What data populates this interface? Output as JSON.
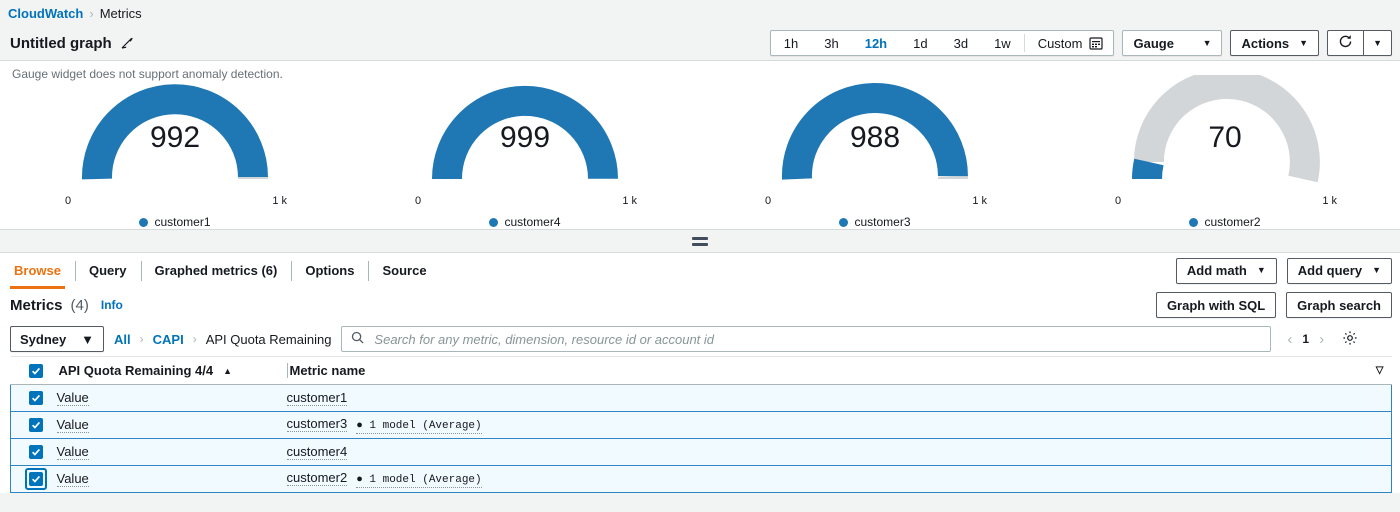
{
  "breadcrumb": {
    "root": "CloudWatch",
    "separator": "›",
    "current": "Metrics"
  },
  "header": {
    "graph_title": "Untitled graph",
    "edit_icon": "pencil-icon",
    "time_ranges": [
      "1h",
      "3h",
      "12h",
      "1d",
      "3d",
      "1w"
    ],
    "active_range": "12h",
    "custom_label": "Custom",
    "calendar_icon": "calendar-icon",
    "widget_type": "Gauge",
    "actions_label": "Actions",
    "refresh_icon": "refresh-icon",
    "caret": "▼"
  },
  "graph": {
    "anomaly_note": "Gauge widget does not support anomaly detection.",
    "min_label": "0",
    "max_label": "1 k",
    "accent_color": "#1f77b4",
    "track_color": "#d2d6d8"
  },
  "chart_data": {
    "type": "gauge",
    "title": "Untitled graph",
    "unit_max_label": "1 k",
    "unit_min_label": "0",
    "range": [
      0,
      1000
    ],
    "series": [
      {
        "name": "customer1",
        "value": 992,
        "display": "992"
      },
      {
        "name": "customer4",
        "value": 999,
        "display": "999"
      },
      {
        "name": "customer3",
        "value": 988,
        "display": "988"
      },
      {
        "name": "customer2",
        "value": 70,
        "display": "70"
      }
    ],
    "legend_position": "bottom",
    "grid": false,
    "xlabel": "",
    "ylabel": ""
  },
  "tabs": {
    "items": [
      {
        "label": "Browse",
        "active": true
      },
      {
        "label": "Query",
        "active": false
      },
      {
        "label": "Graphed metrics (6)",
        "active": false
      },
      {
        "label": "Options",
        "active": false
      },
      {
        "label": "Source",
        "active": false
      }
    ],
    "add_math": "Add math",
    "add_query": "Add query"
  },
  "metrics": {
    "title": "Metrics",
    "count": "(4)",
    "info": "Info",
    "graph_with_sql": "Graph with SQL",
    "graph_search": "Graph search",
    "region": "Sydney",
    "crumbs": [
      {
        "label": "All",
        "link": true
      },
      {
        "label": "CAPI",
        "link": true
      },
      {
        "label": "API Quota Remaining",
        "link": false
      }
    ],
    "crumb_sep": "›",
    "search_placeholder": "Search for any metric, dimension, resource id or account id",
    "search_value": "",
    "search_icon": "search-icon",
    "page_number": "1",
    "prev_icon": "chevron-left-icon",
    "next_icon": "chevron-right-icon",
    "settings_icon": "gear-icon",
    "columns": {
      "checkbox": "select-all",
      "first": "API Quota Remaining 4/4",
      "sort_indicator": "▲",
      "second": "Metric name",
      "filter_indicator": "▽"
    },
    "rows": [
      {
        "checked": true,
        "focused": false,
        "value": "Value",
        "name": "customer1",
        "note": ""
      },
      {
        "checked": true,
        "focused": false,
        "value": "Value",
        "name": "customer3",
        "note": "● 1 model (Average)"
      },
      {
        "checked": true,
        "focused": false,
        "value": "Value",
        "name": "customer4",
        "note": ""
      },
      {
        "checked": true,
        "focused": true,
        "value": "Value",
        "name": "customer2",
        "note": "● 1 model (Average)"
      }
    ]
  }
}
